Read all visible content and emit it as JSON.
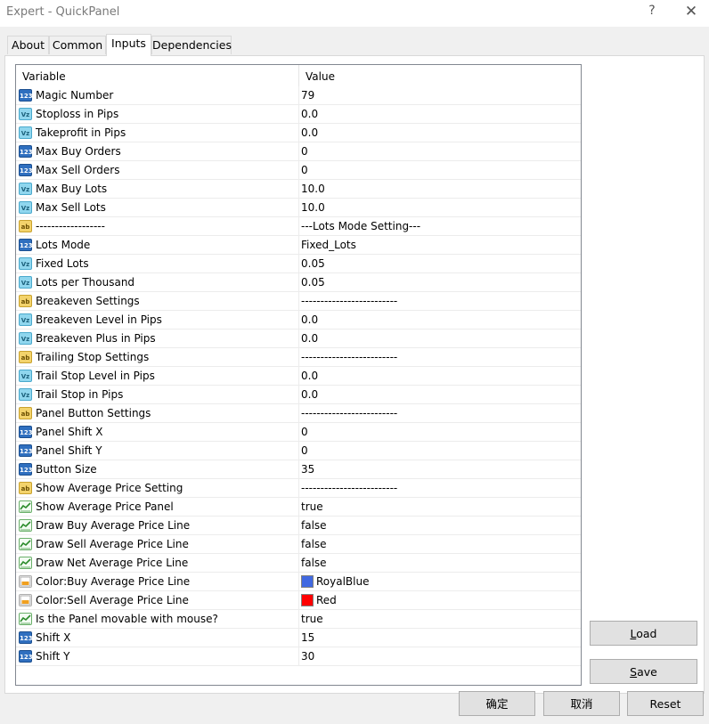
{
  "window": {
    "title": "Expert - QuickPanel",
    "help_label": "?",
    "close_label": "✕"
  },
  "tabs": [
    {
      "label": "About",
      "active": false
    },
    {
      "label": "Common",
      "active": false
    },
    {
      "label": "Inputs",
      "active": true
    },
    {
      "label": "Dependencies",
      "active": false
    }
  ],
  "table": {
    "columns": [
      "Variable",
      "Value"
    ],
    "rows": [
      {
        "type": "int",
        "icon": "int-icon",
        "name": "Magic Number",
        "value": "79"
      },
      {
        "type": "double",
        "icon": "double-icon",
        "name": "Stoploss in Pips",
        "value": "0.0"
      },
      {
        "type": "double",
        "icon": "double-icon",
        "name": "Takeprofit in Pips",
        "value": "0.0"
      },
      {
        "type": "int",
        "icon": "int-icon",
        "name": "Max Buy Orders",
        "value": "0"
      },
      {
        "type": "int",
        "icon": "int-icon",
        "name": "Max Sell Orders",
        "value": "0"
      },
      {
        "type": "double",
        "icon": "double-icon",
        "name": "Max Buy Lots",
        "value": "10.0"
      },
      {
        "type": "double",
        "icon": "double-icon",
        "name": "Max Sell Lots",
        "value": "10.0"
      },
      {
        "type": "string",
        "icon": "string-icon",
        "name": "------------------",
        "value": "---Lots Mode Setting---"
      },
      {
        "type": "int",
        "icon": "int-icon",
        "name": "Lots Mode",
        "value": "Fixed_Lots"
      },
      {
        "type": "double",
        "icon": "double-icon",
        "name": "Fixed Lots",
        "value": "0.05"
      },
      {
        "type": "double",
        "icon": "double-icon",
        "name": "Lots per Thousand",
        "value": "0.05"
      },
      {
        "type": "string",
        "icon": "string-icon",
        "name": "Breakeven Settings",
        "value": "-------------------------"
      },
      {
        "type": "double",
        "icon": "double-icon",
        "name": "Breakeven Level in Pips",
        "value": "0.0"
      },
      {
        "type": "double",
        "icon": "double-icon",
        "name": "Breakeven Plus in Pips",
        "value": "0.0"
      },
      {
        "type": "string",
        "icon": "string-icon",
        "name": "Trailing Stop Settings",
        "value": "-------------------------"
      },
      {
        "type": "double",
        "icon": "double-icon",
        "name": "Trail Stop Level in Pips",
        "value": "0.0"
      },
      {
        "type": "double",
        "icon": "double-icon",
        "name": "Trail Stop in Pips",
        "value": "0.0"
      },
      {
        "type": "string",
        "icon": "string-icon",
        "name": "Panel Button Settings",
        "value": "-------------------------"
      },
      {
        "type": "int",
        "icon": "int-icon",
        "name": "Panel Shift X",
        "value": "0"
      },
      {
        "type": "int",
        "icon": "int-icon",
        "name": "Panel Shift Y",
        "value": "0"
      },
      {
        "type": "int",
        "icon": "int-icon",
        "name": "Button Size",
        "value": "35"
      },
      {
        "type": "string",
        "icon": "string-icon",
        "name": "Show Average Price Setting",
        "value": "-------------------------"
      },
      {
        "type": "bool",
        "icon": "bool-icon",
        "name": "Show Average Price Panel",
        "value": "true"
      },
      {
        "type": "bool",
        "icon": "bool-icon",
        "name": "Draw Buy Average Price Line",
        "value": "false"
      },
      {
        "type": "bool",
        "icon": "bool-icon",
        "name": "Draw Sell Average Price Line",
        "value": "false"
      },
      {
        "type": "bool",
        "icon": "bool-icon",
        "name": "Draw Net Average Price Line",
        "value": "false"
      },
      {
        "type": "color",
        "icon": "color-icon",
        "name": "Color:Buy Average Price Line",
        "value": "RoyalBlue",
        "swatch": "#4169e1"
      },
      {
        "type": "color",
        "icon": "color-icon",
        "name": "Color:Sell Average Price Line",
        "value": "Red",
        "swatch": "#ff0000"
      },
      {
        "type": "bool",
        "icon": "bool-icon",
        "name": "Is the Panel movable with mouse?",
        "value": "true"
      },
      {
        "type": "int",
        "icon": "int-icon",
        "name": "Shift X",
        "value": "15"
      },
      {
        "type": "int",
        "icon": "int-icon",
        "name": "Shift Y",
        "value": "30"
      }
    ]
  },
  "buttons": {
    "load": {
      "label": "Load",
      "mnemonic": "L"
    },
    "save": {
      "label": "Save",
      "mnemonic": "S"
    },
    "ok": "确定",
    "cancel": "取消",
    "reset": "Reset"
  },
  "icon_glyphs": {
    "int": "123",
    "double": "Vz",
    "string": "ab"
  }
}
